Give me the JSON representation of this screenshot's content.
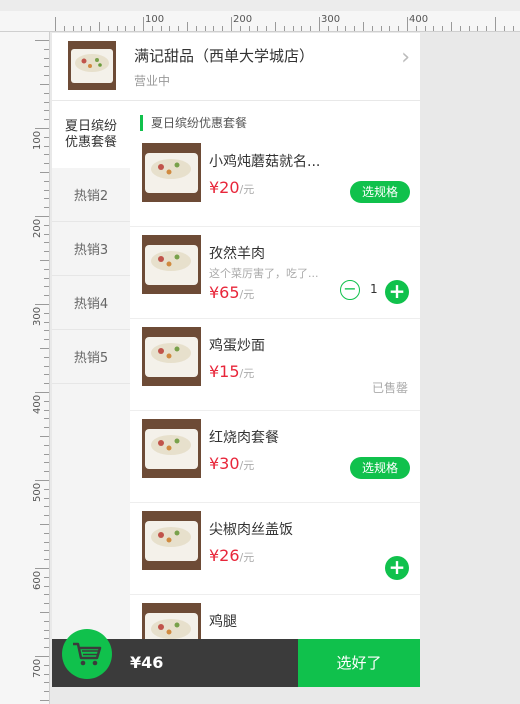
{
  "shop": {
    "name": "满记甜品（西单大学城店）",
    "status": "营业中"
  },
  "sidebar": {
    "items": [
      {
        "label": "夏日缤纷\n优惠套餐"
      },
      {
        "label": "热销2"
      },
      {
        "label": "热销3"
      },
      {
        "label": "热销4"
      },
      {
        "label": "热销5"
      }
    ]
  },
  "category": {
    "title": "夏日缤纷优惠套餐"
  },
  "items": [
    {
      "name": "小鸡炖蘑菇就名...",
      "price": "¥20",
      "unit": "/元",
      "action": "选规格"
    },
    {
      "name": "孜然羊肉",
      "desc": "这个菜厉害了，吃了...",
      "price": "¥65",
      "unit": "/元",
      "qty": "1"
    },
    {
      "name": "鸡蛋炒面",
      "price": "¥15",
      "unit": "/元",
      "status": "已售罄"
    },
    {
      "name": "红烧肉套餐",
      "price": "¥30",
      "unit": "/元",
      "action": "选规格"
    },
    {
      "name": "尖椒肉丝盖饭",
      "price": "¥26",
      "unit": "/元"
    },
    {
      "name": "鸡腿"
    }
  ],
  "cart": {
    "total": "¥46",
    "checkout_label": "选好了"
  },
  "ruler": {
    "top_labels": [
      "100",
      "200",
      "300",
      "400"
    ],
    "left_labels": [
      "100",
      "200",
      "300",
      "400",
      "500",
      "600",
      "700"
    ]
  },
  "colors": {
    "accent": "#10c14c",
    "price": "#e8263a",
    "bar": "#3b3b3b"
  }
}
